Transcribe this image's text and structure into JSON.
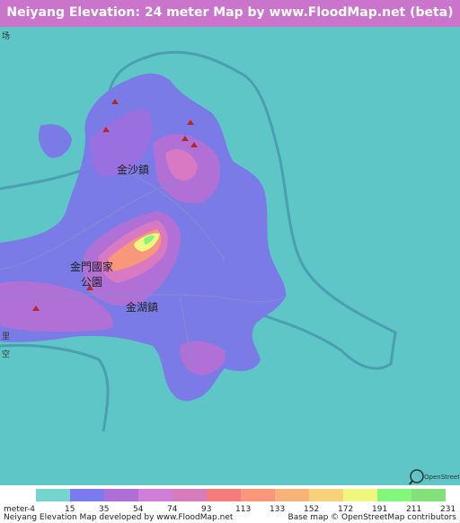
{
  "title": "Neiyang Elevation: 24 meter Map by www.FloodMap.net (beta)",
  "colors": {
    "header": "#ca74cb",
    "sea": "#5ec6c6",
    "land_low": "#7b7be8",
    "land_mid": "#b070d6",
    "land_high": "#d979c3"
  },
  "map_labels": {
    "town_north": "金沙鎮",
    "park_line1": "金門國家",
    "park_line2": "公園",
    "town_south": "金湖鎮",
    "edge_top_left": "场",
    "edge_left_1": "里",
    "edge_left_2": "空"
  },
  "legend": {
    "unit": "meter",
    "values": [
      "-4",
      "15",
      "35",
      "54",
      "74",
      "93",
      "113",
      "133",
      "152",
      "172",
      "191",
      "211",
      "231"
    ],
    "swatch_colors": [
      "#76d4cf",
      "#7b7bef",
      "#ad6fd6",
      "#d07fd8",
      "#d67bbc",
      "#f47c7c",
      "#f8977b",
      "#f8b379",
      "#f7d27a",
      "#eff77e",
      "#82f77c",
      "#83e07b"
    ]
  },
  "footer": {
    "left": "Neiyang Elevation Map developed by www.FloodMap.net",
    "right": "Base map © OpenStreetMap contributors"
  },
  "attribution_badge": "OpenStreetMap"
}
